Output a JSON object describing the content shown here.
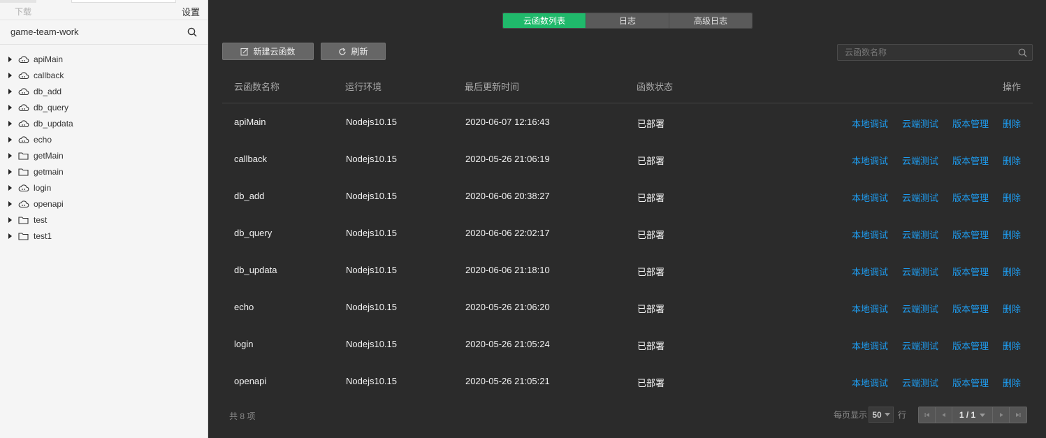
{
  "sidebar": {
    "download_label": "下载",
    "settings_label": "设置",
    "project_name": "game-team-work",
    "items": [
      {
        "label": "apiMain",
        "icon": "cloud-icon"
      },
      {
        "label": "callback",
        "icon": "cloud-icon"
      },
      {
        "label": "db_add",
        "icon": "cloud-icon"
      },
      {
        "label": "db_query",
        "icon": "cloud-icon"
      },
      {
        "label": "db_updata",
        "icon": "cloud-icon"
      },
      {
        "label": "echo",
        "icon": "cloud-icon"
      },
      {
        "label": "getMain",
        "icon": "folder-icon"
      },
      {
        "label": "getmain",
        "icon": "folder-icon"
      },
      {
        "label": "login",
        "icon": "cloud-icon"
      },
      {
        "label": "openapi",
        "icon": "cloud-icon"
      },
      {
        "label": "test",
        "icon": "folder-icon"
      },
      {
        "label": "test1",
        "icon": "folder-icon"
      }
    ]
  },
  "tabs": [
    {
      "label": "云函数列表",
      "active": true
    },
    {
      "label": "日志",
      "active": false
    },
    {
      "label": "高级日志",
      "active": false
    }
  ],
  "toolbar": {
    "new_label": "新建云函数",
    "refresh_label": "刷新",
    "search_placeholder": "云函数名称"
  },
  "table": {
    "headers": {
      "name": "云函数名称",
      "env": "运行环境",
      "time": "最后更新时间",
      "status": "函数状态",
      "ops": "操作"
    },
    "rows": [
      {
        "name": "apiMain",
        "env": "Nodejs10.15",
        "time": "2020-06-07 12:16:43",
        "status": "已部署"
      },
      {
        "name": "callback",
        "env": "Nodejs10.15",
        "time": "2020-05-26 21:06:19",
        "status": "已部署"
      },
      {
        "name": "db_add",
        "env": "Nodejs10.15",
        "time": "2020-06-06 20:38:27",
        "status": "已部署"
      },
      {
        "name": "db_query",
        "env": "Nodejs10.15",
        "time": "2020-06-06 22:02:17",
        "status": "已部署"
      },
      {
        "name": "db_updata",
        "env": "Nodejs10.15",
        "time": "2020-06-06 21:18:10",
        "status": "已部署"
      },
      {
        "name": "echo",
        "env": "Nodejs10.15",
        "time": "2020-05-26 21:06:20",
        "status": "已部署"
      },
      {
        "name": "login",
        "env": "Nodejs10.15",
        "time": "2020-05-26 21:05:24",
        "status": "已部署"
      },
      {
        "name": "openapi",
        "env": "Nodejs10.15",
        "time": "2020-05-26 21:05:21",
        "status": "已部署"
      }
    ],
    "actions": {
      "local_debug": "本地调试",
      "cloud_test": "云端测试",
      "version_mgmt": "版本管理",
      "delete": "删除"
    }
  },
  "footer": {
    "total": "共 8 项",
    "per_page_prefix": "每页显示",
    "per_page_value": "50",
    "per_page_suffix": "行",
    "page": "1 / 1"
  },
  "colors": {
    "accent": "#20b96b",
    "link": "#1e9cf0",
    "background": "#2b2b2b"
  }
}
